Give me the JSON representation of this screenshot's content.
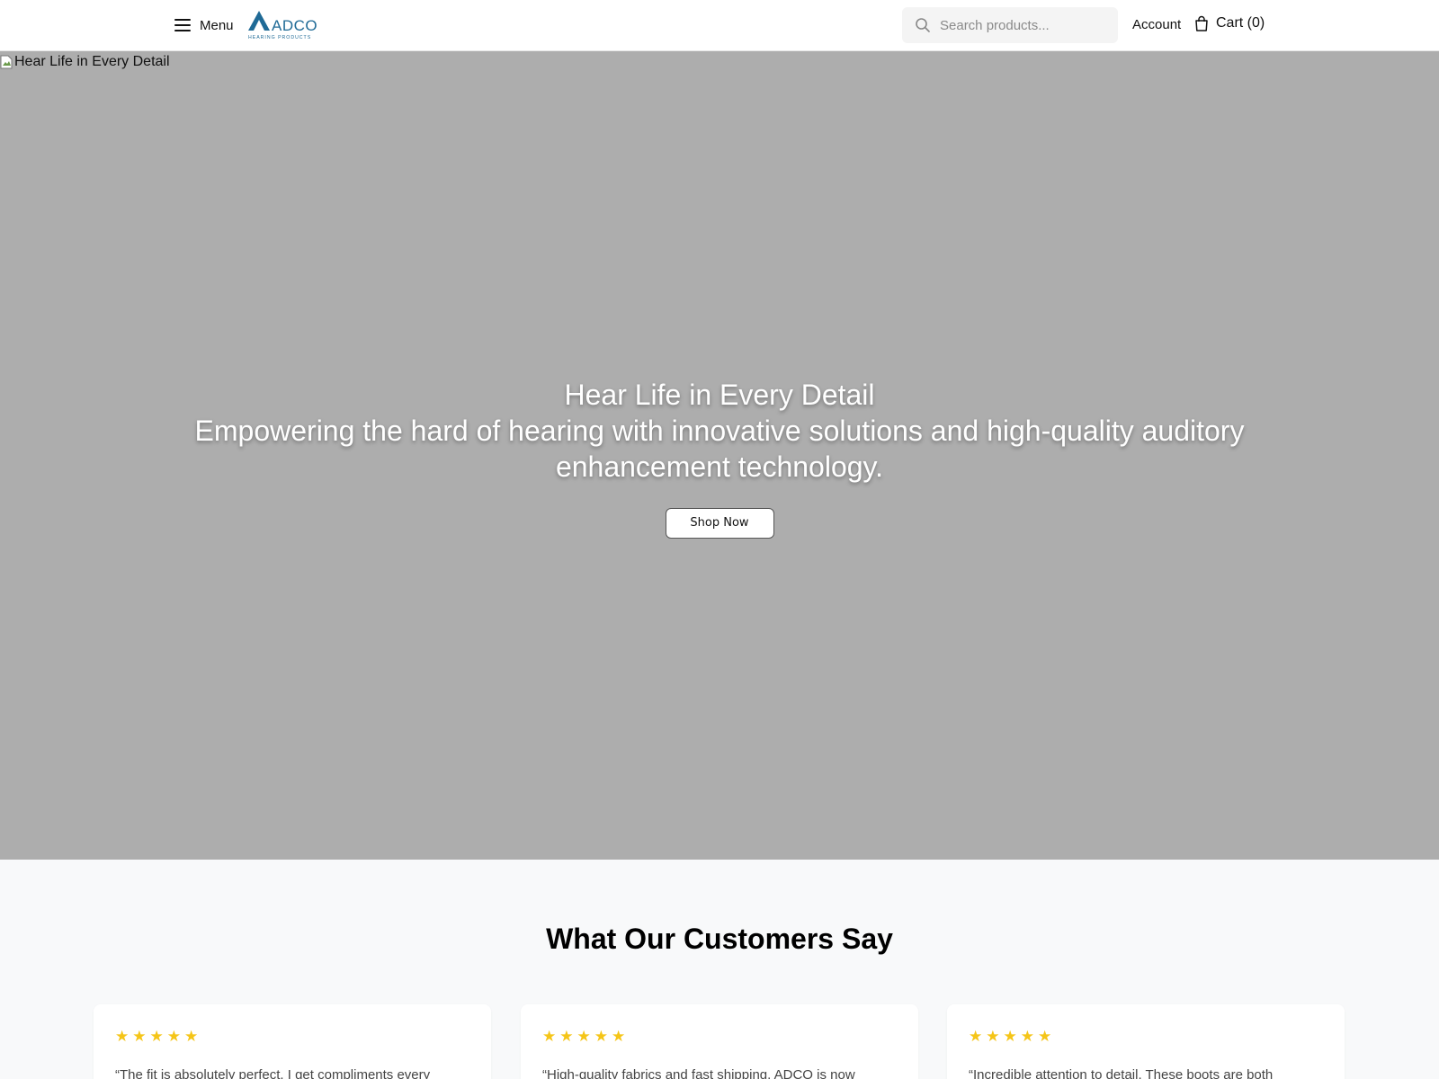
{
  "header": {
    "menu_label": "Menu",
    "logo": {
      "brand": "ADCO",
      "tagline": "HEARING PRODUCTS",
      "color": "#1f6a96"
    },
    "search_placeholder": "Search products...",
    "account_label": "Account",
    "cart_label": "Cart (0)"
  },
  "hero": {
    "broken_image_alt": "Hear Life in Every Detail",
    "title": "Hear Life in Every Detail",
    "subtitle": "Empowering the hard of hearing with innovative solutions and high-quality auditory enhancement technology.",
    "cta_label": "Shop Now",
    "background_color": "#adadad"
  },
  "testimonials": {
    "title": "What Our Customers Say",
    "star_color": "#f5c518",
    "items": [
      {
        "rating": 5,
        "quote": "“The fit is absolutely perfect. I get compliments every"
      },
      {
        "rating": 5,
        "quote": "“High-quality fabrics and fast shipping. ADCO is now"
      },
      {
        "rating": 5,
        "quote": "“Incredible attention to detail. These boots are both"
      }
    ]
  }
}
